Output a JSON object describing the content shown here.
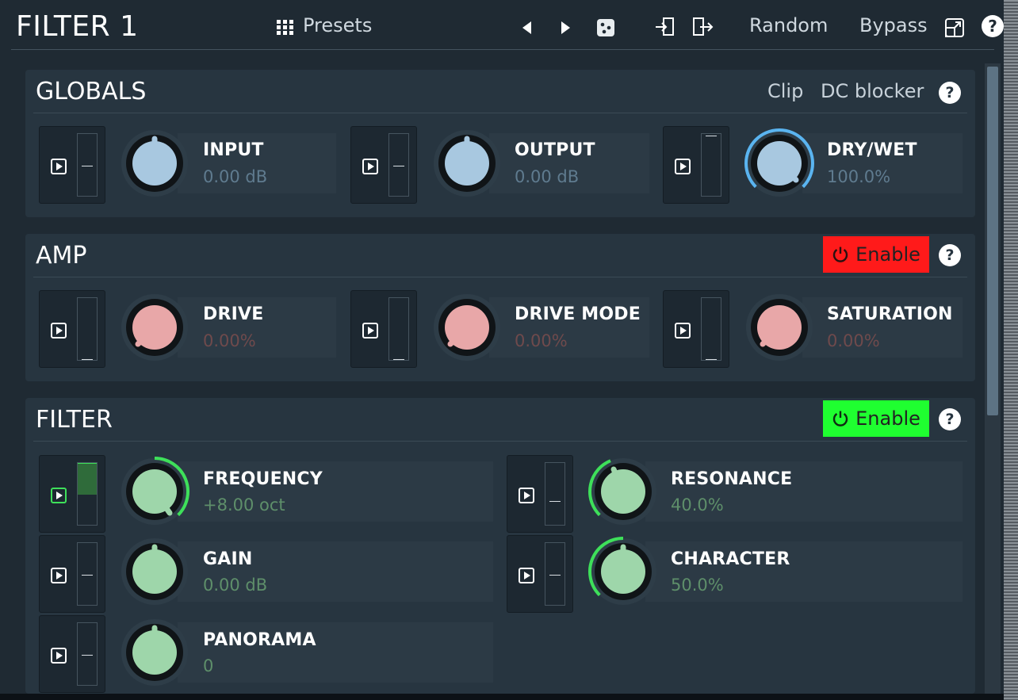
{
  "app": {
    "title": "FILTER 1",
    "presets_label": "Presets",
    "random_label": "Random",
    "bypass_label": "Bypass",
    "help_label": "?"
  },
  "colors": {
    "globals_knob": "#a8c8e0",
    "amp_knob": "#e8a7a8",
    "filter_knob": "#9ed6aa",
    "enable_on_amp": "#ff1a1a",
    "enable_on_filter": "#1fff30",
    "arc_blue": "#5ab4f0",
    "arc_green": "#3ee05a"
  },
  "globals": {
    "title": "GLOBALS",
    "clip_label": "Clip",
    "dc_blocker_label": "DC blocker",
    "help_label": "?",
    "params": [
      {
        "label": "INPUT",
        "value": "0.00 dB"
      },
      {
        "label": "OUTPUT",
        "value": "0.00 dB"
      },
      {
        "label": "DRY/WET",
        "value": "100.0%"
      }
    ]
  },
  "amp": {
    "title": "AMP",
    "enable_label": "Enable",
    "help_label": "?",
    "params": [
      {
        "label": "DRIVE",
        "value": "0.00%"
      },
      {
        "label": "DRIVE MODE",
        "value": "0.00%"
      },
      {
        "label": "SATURATION",
        "value": "0.00%"
      }
    ]
  },
  "filter": {
    "title": "FILTER",
    "enable_label": "Enable",
    "help_label": "?",
    "params": [
      {
        "label": "FREQUENCY",
        "value": "+8.00 oct"
      },
      {
        "label": "RESONANCE",
        "value": "40.0%"
      },
      {
        "label": "GAIN",
        "value": "0.00 dB"
      },
      {
        "label": "CHARACTER",
        "value": "50.0%"
      },
      {
        "label": "PANORAMA",
        "value": "0"
      }
    ]
  }
}
